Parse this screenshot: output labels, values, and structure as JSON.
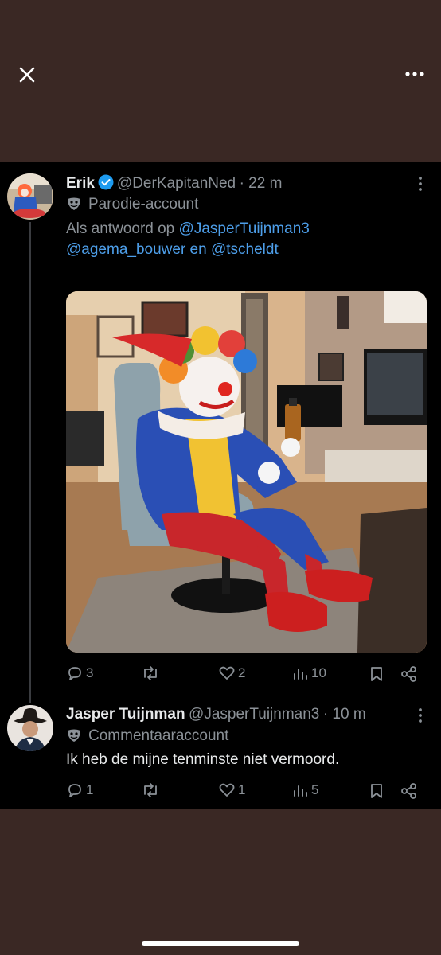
{
  "header": {
    "close_icon": "close-icon",
    "more_icon": "more-horizontal-icon"
  },
  "tweet1": {
    "name": "Erik",
    "handle": "@DerKapitanNed",
    "time": "· 22 m",
    "account_type": "Parodie-account",
    "reply_prefix": "Als antwoord op",
    "reply_to_1": "@JasperTuijnman3",
    "reply_to_2": "@agema_bouwer",
    "reply_join": "en",
    "reply_to_3": "@tscheldt",
    "stats": {
      "replies": "3",
      "reposts": "",
      "likes": "2",
      "views": "10"
    }
  },
  "tweet2": {
    "name": "Jasper Tuijnman",
    "handle": "@JasperTuijnman3",
    "time": "· 10 m",
    "account_type": "Commentaaraccount",
    "text": "Ik heb de mijne tenminste niet vermoord.",
    "stats": {
      "replies": "1",
      "reposts": "",
      "likes": "1",
      "views": "5"
    }
  },
  "colors": {
    "link": "#4d9ee9",
    "verified": "#1d9bf0",
    "muted": "#8b9197",
    "background": "#3a2824"
  }
}
